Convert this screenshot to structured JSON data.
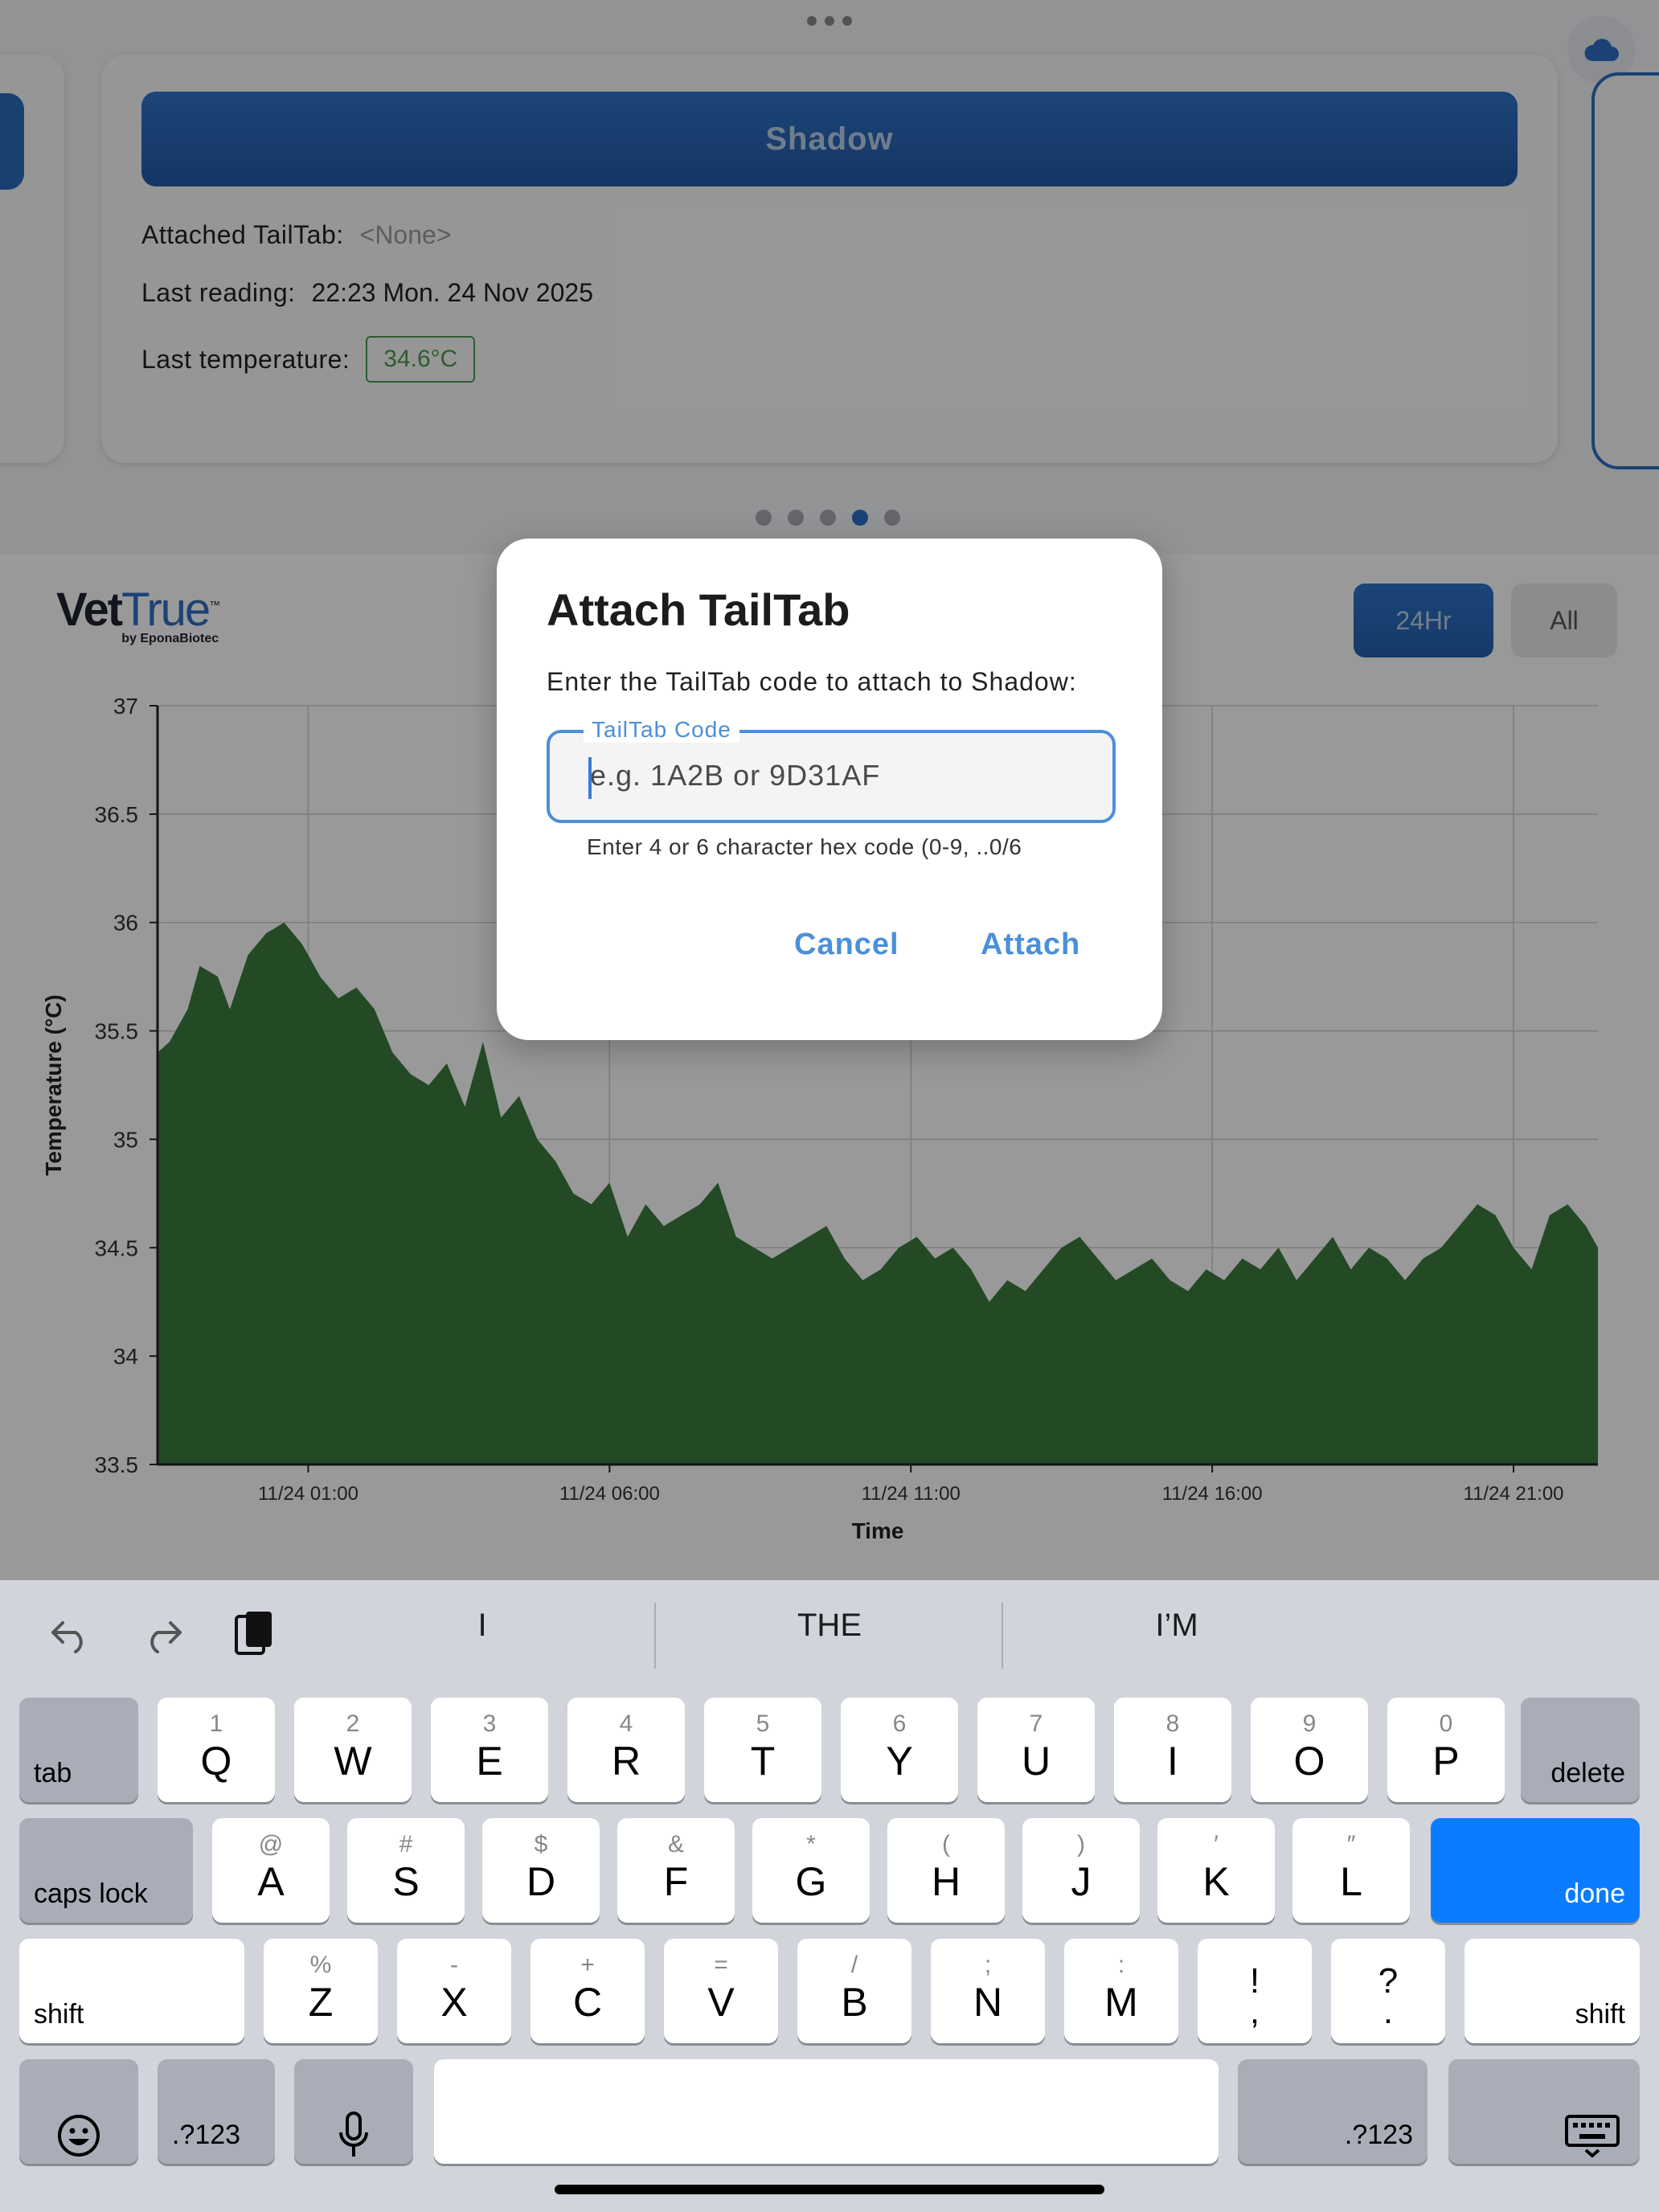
{
  "horse_card": {
    "name": "Shadow",
    "attached_label": "Attached TailTab:",
    "attached_value": "<None>",
    "reading_label": "Last reading:",
    "reading_value": "22:23 Mon. 24 Nov 2025",
    "temp_label": "Last temperature:",
    "temp_value": "34.6°C"
  },
  "pager": {
    "count": 5,
    "active_index": 3
  },
  "logo": {
    "main_a": "Vet",
    "main_b": "True",
    "sub": "by EponaBiotec",
    "tm": "™"
  },
  "range_buttons": {
    "day": "24Hr",
    "all": "All"
  },
  "chart_data": {
    "type": "area",
    "xlabel": "Time",
    "ylabel": "Temperature (°C)",
    "ylim": [
      33.5,
      37
    ],
    "yticks": [
      37,
      36.5,
      36,
      35.5,
      35,
      34.5,
      34,
      33.5
    ],
    "xticks": [
      "11/24 01:00",
      "11/24 06:00",
      "11/24 11:00",
      "11/24 16:00",
      "11/24 21:00"
    ],
    "xtick_hours": [
      1,
      6,
      11,
      16,
      21
    ],
    "x_hours": [
      -1.5,
      -1.3,
      -1.0,
      -0.8,
      -0.5,
      -0.3,
      0.0,
      0.3,
      0.6,
      0.9,
      1.2,
      1.5,
      1.8,
      2.1,
      2.4,
      2.7,
      3.0,
      3.3,
      3.6,
      3.9,
      4.2,
      4.5,
      4.8,
      5.1,
      5.4,
      5.7,
      6.0,
      6.3,
      6.6,
      6.9,
      7.2,
      7.5,
      7.8,
      8.1,
      8.4,
      8.7,
      9.0,
      9.3,
      9.6,
      9.9,
      10.2,
      10.5,
      10.8,
      11.1,
      11.4,
      11.7,
      12.0,
      12.3,
      12.6,
      12.9,
      13.2,
      13.5,
      13.8,
      14.1,
      14.4,
      14.7,
      15.0,
      15.3,
      15.6,
      15.9,
      16.2,
      16.5,
      16.8,
      17.1,
      17.4,
      17.7,
      18.0,
      18.3,
      18.6,
      18.9,
      19.2,
      19.5,
      19.8,
      20.1,
      20.4,
      20.7,
      21.0,
      21.3,
      21.6,
      21.9,
      22.2,
      22.4
    ],
    "values": [
      35.4,
      35.45,
      35.6,
      35.8,
      35.75,
      35.6,
      35.85,
      35.95,
      36.0,
      35.9,
      35.75,
      35.65,
      35.7,
      35.6,
      35.4,
      35.3,
      35.25,
      35.35,
      35.15,
      35.45,
      35.1,
      35.2,
      35.0,
      34.9,
      34.75,
      34.7,
      34.8,
      34.55,
      34.7,
      34.6,
      34.65,
      34.7,
      34.8,
      34.55,
      34.5,
      34.45,
      34.5,
      34.55,
      34.6,
      34.45,
      34.35,
      34.4,
      34.5,
      34.55,
      34.45,
      34.5,
      34.4,
      34.25,
      34.35,
      34.3,
      34.4,
      34.5,
      34.55,
      34.45,
      34.35,
      34.4,
      34.45,
      34.35,
      34.3,
      34.4,
      34.35,
      34.45,
      34.4,
      34.5,
      34.35,
      34.45,
      34.55,
      34.4,
      34.5,
      34.45,
      34.35,
      34.45,
      34.5,
      34.6,
      34.7,
      34.65,
      34.5,
      34.4,
      34.65,
      34.7,
      34.6,
      34.5
    ],
    "fill_color": "#3b7a3f",
    "grid": true
  },
  "dialog": {
    "title": "Attach TailTab",
    "message": "Enter the TailTab code to attach to Shadow:",
    "field_label": "TailTab Code",
    "placeholder": "e.g. 1A2B or 9D31AF",
    "value": "",
    "helper": "Enter 4 or 6 character hex code (0-9, ..0/6",
    "cancel": "Cancel",
    "attach": "Attach"
  },
  "keyboard": {
    "suggestions": [
      "I",
      "THE",
      "I’M"
    ],
    "row1": [
      {
        "main": "Q",
        "alt": "1"
      },
      {
        "main": "W",
        "alt": "2"
      },
      {
        "main": "E",
        "alt": "3"
      },
      {
        "main": "R",
        "alt": "4"
      },
      {
        "main": "T",
        "alt": "5"
      },
      {
        "main": "Y",
        "alt": "6"
      },
      {
        "main": "U",
        "alt": "7"
      },
      {
        "main": "I",
        "alt": "8"
      },
      {
        "main": "O",
        "alt": "9"
      },
      {
        "main": "P",
        "alt": "0"
      }
    ],
    "row2": [
      {
        "main": "A",
        "alt": "@"
      },
      {
        "main": "S",
        "alt": "#"
      },
      {
        "main": "D",
        "alt": "$"
      },
      {
        "main": "F",
        "alt": "&"
      },
      {
        "main": "G",
        "alt": "*"
      },
      {
        "main": "H",
        "alt": "("
      },
      {
        "main": "J",
        "alt": ")"
      },
      {
        "main": "K",
        "alt": "′"
      },
      {
        "main": "L",
        "alt": "″"
      }
    ],
    "row3": [
      {
        "main": "Z",
        "alt": "%"
      },
      {
        "main": "X",
        "alt": "-"
      },
      {
        "main": "C",
        "alt": "+"
      },
      {
        "main": "V",
        "alt": "="
      },
      {
        "main": "B",
        "alt": "/"
      },
      {
        "main": "N",
        "alt": ";"
      },
      {
        "main": "M",
        "alt": ":"
      }
    ],
    "punct1": {
      "top": "!",
      "bottom": ","
    },
    "punct2": {
      "top": "?",
      "bottom": "."
    },
    "tab": "tab",
    "delete": "delete",
    "caps": "caps lock",
    "done": "done",
    "shift": "shift",
    "numbers": ".?123"
  }
}
